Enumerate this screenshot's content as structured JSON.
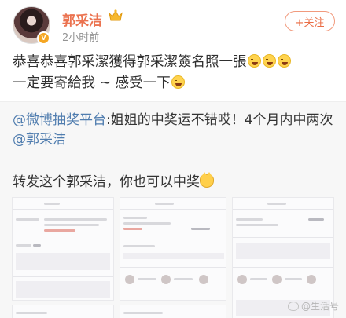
{
  "post": {
    "author": "郭采洁",
    "time": "2小时前",
    "follow_label": "+关注",
    "text_line1": "恭喜恭喜郭采潔獲得郭采潔簽名照一張",
    "text_line2": "一定要寄給我 ~ 感受一下",
    "emoji_line1": [
      "laugh-cry-emoji",
      "laugh-cry-emoji",
      "laugh-cry-emoji"
    ],
    "emoji_line2": [
      "laugh-cry-emoji"
    ]
  },
  "repost": {
    "mention_platform": "@微博抽奖平台",
    "text": ":姐姐的中奖运不错哎！4个月内中两次",
    "mention_user": "@郭采洁",
    "line2": "转发这个郭采洁，你也可以中奖",
    "line2_emoji": "cat-smile-emoji"
  },
  "watermark": "@生活号",
  "colors": {
    "author_name": "#eb7350",
    "mention": "#507daf",
    "follow_border": "#f19a7d",
    "repost_bg": "#f7f7f7"
  }
}
